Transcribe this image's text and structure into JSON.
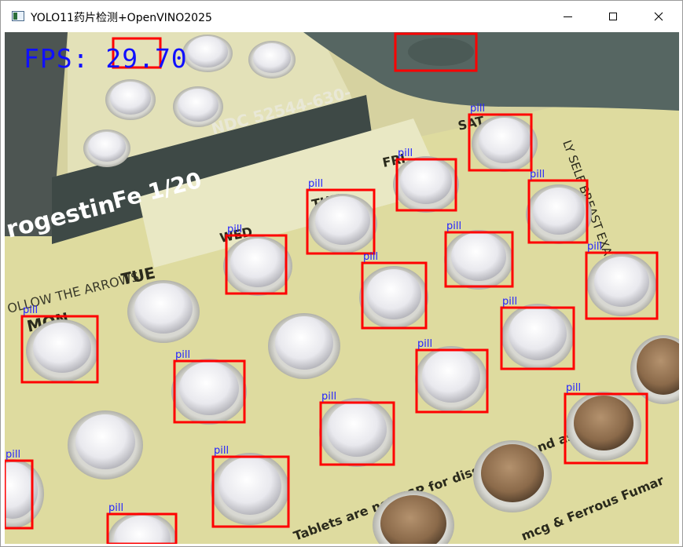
{
  "window": {
    "title": "YOLO11药片检测+OpenVINO2025",
    "controls": [
      "minimize",
      "maximize",
      "close"
    ],
    "icon": "app-window-icon"
  },
  "overlay": {
    "fps_text": "FPS: 29.70",
    "fps_color": "#1010ff",
    "box_color": "#ff0000",
    "label_color": "#2323ff"
  },
  "package_text": {
    "ndc": "NDC 52544-630-",
    "brand": "rogestin",
    "brand_suffix": "Fe 1/20",
    "follow": "OLLOW THE ARROWS",
    "days": [
      "MON",
      "TUE",
      "WED",
      "THU",
      "FRI",
      "SAT"
    ],
    "side": "LY SELF BREAST EXAM",
    "bottom1": "Tablets are not USP for dissolution and assay",
    "bottom2": "mcg & Ferrous Fumar",
    "top_days": [
      "THU",
      "WED"
    ]
  },
  "detections": [
    {
      "label": "pill"
    },
    {
      "label": "pill"
    },
    {
      "label": "pill"
    },
    {
      "label": "pill"
    },
    {
      "label": "pill"
    },
    {
      "label": "pill"
    },
    {
      "label": "pill"
    },
    {
      "label": "pill"
    },
    {
      "label": "pill"
    },
    {
      "label": "pill"
    },
    {
      "label": "pill"
    },
    {
      "label": "pill"
    },
    {
      "label": "pill"
    },
    {
      "label": "pill"
    },
    {
      "label": "pill"
    },
    {
      "label": "pill"
    },
    {
      "label": "pill"
    }
  ]
}
